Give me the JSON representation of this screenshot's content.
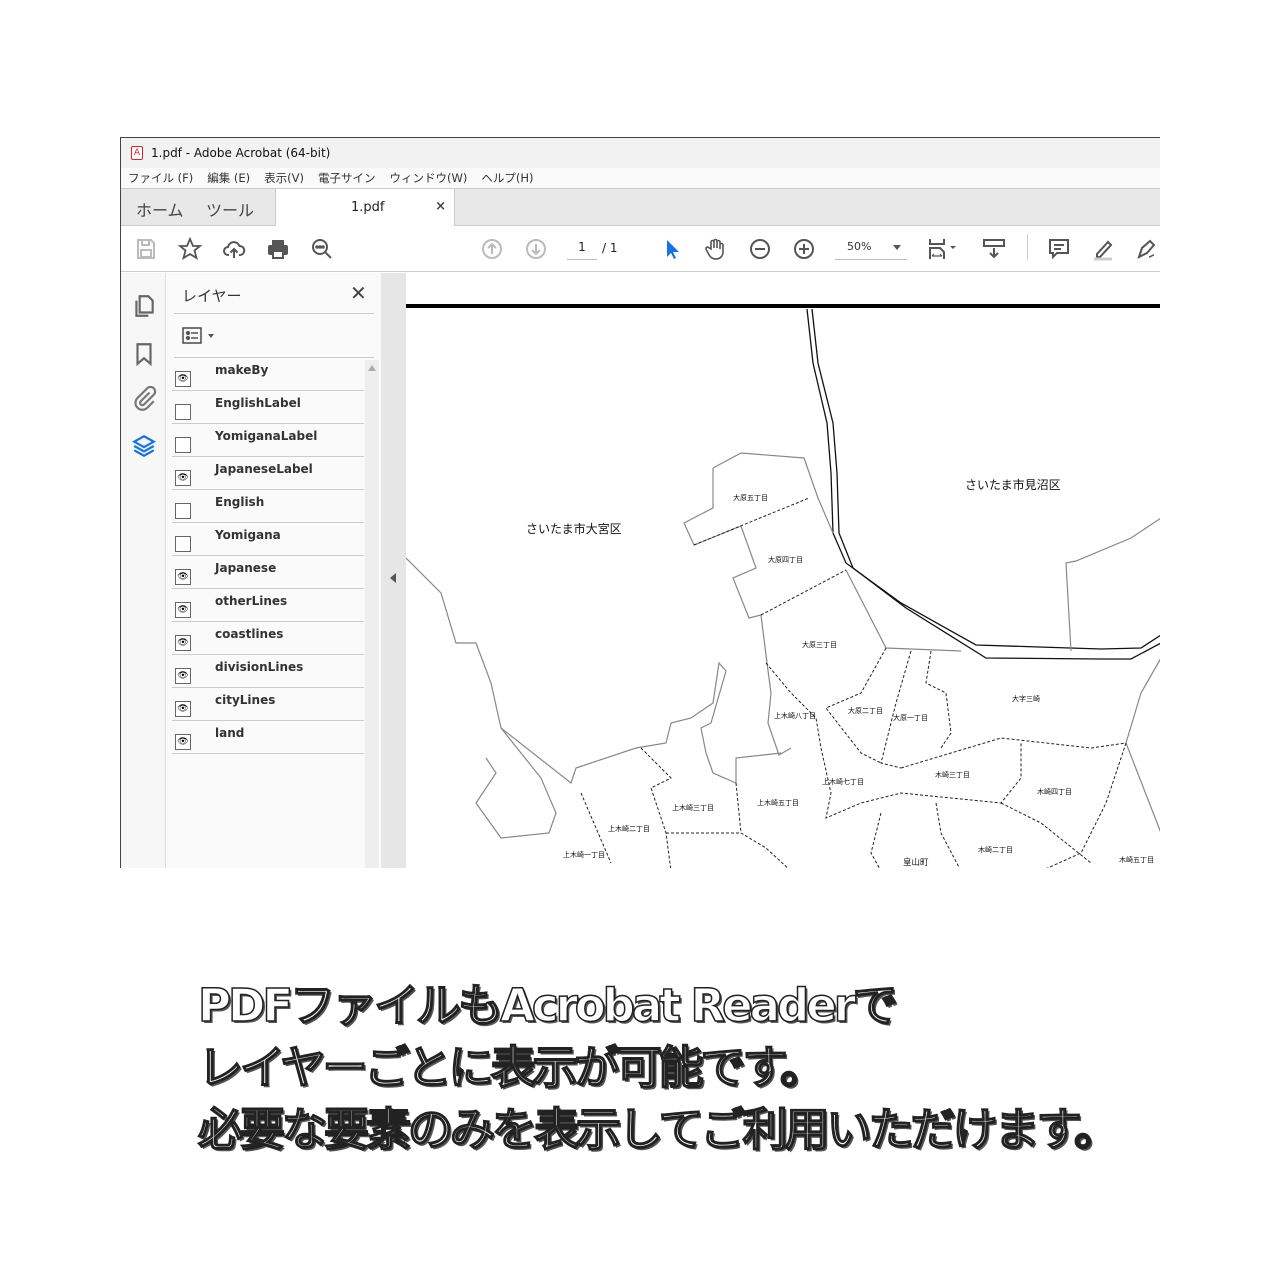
{
  "window": {
    "title": "1.pdf - Adobe Acrobat (64-bit)"
  },
  "menu": [
    "ファイル (F)",
    "編集 (E)",
    "表示(V)",
    "電子サイン",
    "ウィンドウ(W)",
    "ヘルプ(H)"
  ],
  "tabs": {
    "home": "ホーム",
    "tools": "ツール",
    "document": "1.pdf",
    "close": "×"
  },
  "toolbar": {
    "page_current": "1",
    "page_total": "/ 1",
    "zoom": "50%",
    "accent": "#1473e6"
  },
  "layers_panel": {
    "title": "レイヤー",
    "close": "✕",
    "layers": [
      {
        "name": "makeBy",
        "visible": true
      },
      {
        "name": "EnglishLabel",
        "visible": false
      },
      {
        "name": "YomiganaLabel",
        "visible": false
      },
      {
        "name": "JapaneseLabel",
        "visible": true
      },
      {
        "name": "English",
        "visible": false
      },
      {
        "name": "Yomigana",
        "visible": false
      },
      {
        "name": "Japanese",
        "visible": true
      },
      {
        "name": "otherLines",
        "visible": true
      },
      {
        "name": "coastlines",
        "visible": true
      },
      {
        "name": "divisionLines",
        "visible": true
      },
      {
        "name": "cityLines",
        "visible": true
      },
      {
        "name": "land",
        "visible": true
      }
    ]
  },
  "map": {
    "wards": [
      "さいたま市大宮区",
      "さいたま市見沼区"
    ],
    "towns": [
      "大原五丁目",
      "大原四丁目",
      "大原三丁目",
      "大原二丁目",
      "大原一丁目",
      "大字三崎",
      "上木崎八丁目",
      "上木崎七丁目",
      "上木崎五丁目",
      "上木崎三丁目",
      "上木崎二丁目",
      "上木崎一丁目",
      "木崎三丁目",
      "木崎四丁目",
      "木崎二丁目",
      "木崎五丁目",
      "皇山町"
    ]
  },
  "caption": [
    "PDFファイルもAcrobat Readerで",
    "レイヤーごとに表示が可能です。",
    "必要な要素のみを表示してご利用いただけます。"
  ]
}
